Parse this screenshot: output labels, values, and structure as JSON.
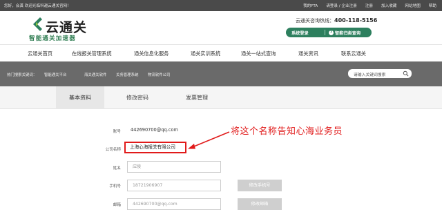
{
  "topbar": {
    "welcome": "您好，会龚  欢迎光临科越云通关官网！",
    "links": [
      "我的FTA",
      "请登录 / 企业注册",
      "注册",
      "加入收藏",
      "网站地图",
      "帮助"
    ]
  },
  "header": {
    "logo_name": "云通关",
    "slogan": "智能通关加速器",
    "hotline_label": "云通关咨询热线：",
    "hotline_number": "400-118-5156",
    "login_button": "系统登录",
    "query_button": "智能归类查询"
  },
  "nav": {
    "items": [
      "云通关首页",
      "在线报关管理系统",
      "通关信息化服务",
      "通关实训系统",
      "通关一站式查询",
      "通关资讯",
      "联系云通关"
    ]
  },
  "hotsearch": {
    "label": "热门搜索关键词：",
    "keywords": [
      "智能通关平台",
      "海关通关软件",
      "关务管理系统",
      "物流软件公司"
    ],
    "search_placeholder": "请输入关键词搜索"
  },
  "tabs": [
    "基本资料",
    "修改密码",
    "发票管理"
  ],
  "form": {
    "account_label": "账号",
    "account_value": "442690700@qq.com",
    "company_label": "公司名称",
    "company_value": "上海心海报关有限公司",
    "name_label": "姓名",
    "name_placeholder": "应俊",
    "phone_label": "手机号",
    "phone_value": "18721906907",
    "change_phone_button": "修改手机号",
    "email_label": "邮箱",
    "email_value": "442690700@qq.com",
    "change_email_button": "修改邮箱"
  },
  "annotation": "将这个名称告知心海业务员",
  "colors": {
    "brand_green": "#2d7f5e",
    "highlight_red": "#e11a1a",
    "topbar": "#4a4a4a",
    "hotbar": "#6a6a6a"
  }
}
